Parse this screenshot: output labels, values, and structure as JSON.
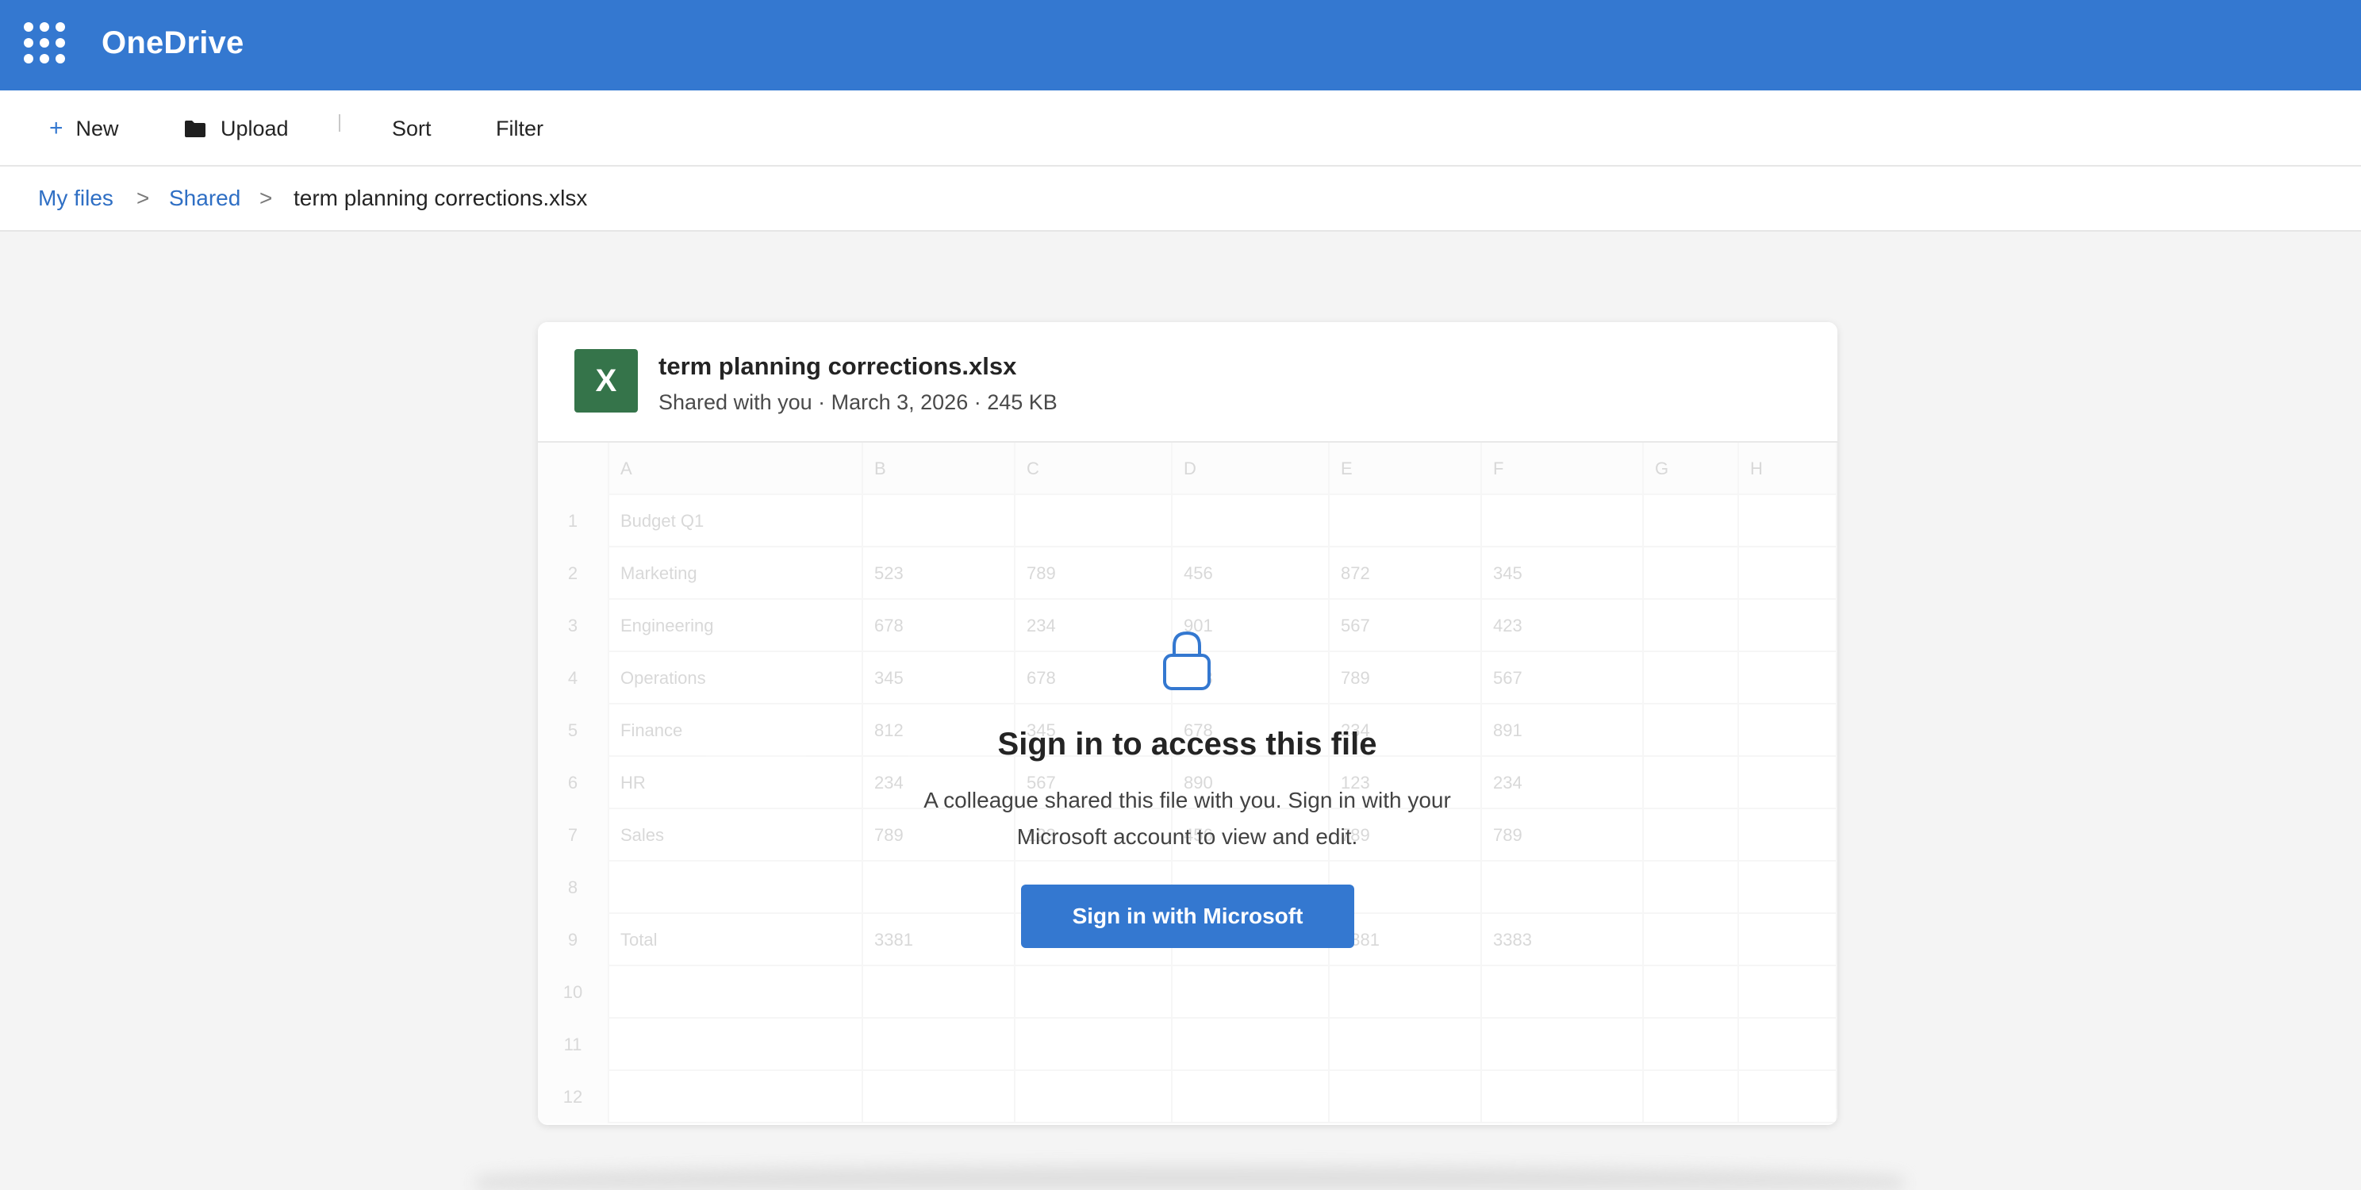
{
  "app": {
    "brand": "OneDrive",
    "accent_color": "#3478d0",
    "icons": {
      "app_launcher": "waffle-grid-icon"
    }
  },
  "commandbar": {
    "new_label": "New",
    "upload_label": "Upload",
    "sort_label": "Sort",
    "filter_label": "Filter",
    "icons": {
      "new": "plus-icon",
      "upload": "folder-icon"
    }
  },
  "breadcrumb": {
    "items": [
      "My files",
      "Shared",
      "term planning corrections.xlsx"
    ],
    "separator": ">"
  },
  "file": {
    "icon_letter": "X",
    "icon_color": "#35744a",
    "name": "term planning corrections.xlsx",
    "meta": "Shared with you · March 3, 2026 · 245 KB"
  },
  "sheet": {
    "columns": [
      "A",
      "B",
      "C",
      "D",
      "E",
      "F",
      "G",
      "H"
    ],
    "rows": [
      {
        "num": "1",
        "cells": [
          "Budget Q1",
          "",
          "",
          "",
          "",
          "",
          "",
          ""
        ]
      },
      {
        "num": "2",
        "cells": [
          "Marketing",
          "523",
          "789",
          "456",
          "872",
          "345",
          "",
          ""
        ]
      },
      {
        "num": "3",
        "cells": [
          "Engineering",
          "678",
          "234",
          "901",
          "567",
          "423",
          "",
          ""
        ]
      },
      {
        "num": "4",
        "cells": [
          "Operations",
          "345",
          "678",
          "123",
          "789",
          "567",
          "",
          ""
        ]
      },
      {
        "num": "5",
        "cells": [
          "Finance",
          "812",
          "345",
          "678",
          "234",
          "891",
          "",
          ""
        ]
      },
      {
        "num": "6",
        "cells": [
          "HR",
          "234",
          "567",
          "890",
          "123",
          "234",
          "",
          ""
        ]
      },
      {
        "num": "7",
        "cells": [
          "Sales",
          "789",
          "123",
          "456",
          "789",
          "789",
          "",
          ""
        ]
      },
      {
        "num": "8",
        "cells": [
          "",
          "",
          "",
          "",
          "",
          "",
          "",
          ""
        ]
      },
      {
        "num": "9",
        "cells": [
          "Total",
          "3381",
          "",
          "",
          "3381",
          "3383",
          "",
          ""
        ]
      },
      {
        "num": "10",
        "cells": [
          "",
          "",
          "",
          "",
          "",
          "",
          "",
          ""
        ]
      },
      {
        "num": "11",
        "cells": [
          "",
          "",
          "",
          "",
          "",
          "",
          "",
          ""
        ]
      },
      {
        "num": "12",
        "cells": [
          "",
          "",
          "",
          "",
          "",
          "",
          "",
          ""
        ]
      }
    ]
  },
  "signin": {
    "icon": "lock-icon",
    "title": "Sign in to access this file",
    "body_line1": "A colleague shared this file with you. Sign in with your",
    "body_line2": "Microsoft account to view and edit.",
    "button_label": "Sign in with Microsoft"
  }
}
